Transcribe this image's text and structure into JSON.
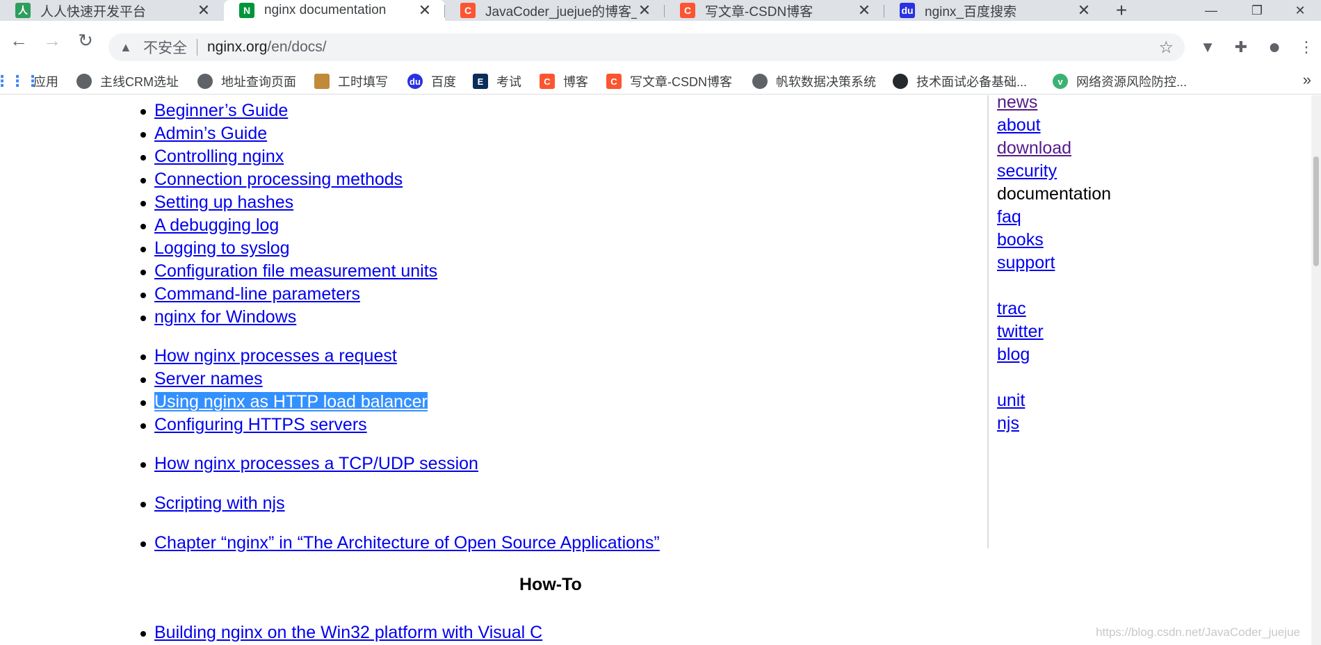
{
  "tabs": [
    {
      "title": "人人快速开发平台",
      "favicon": "renren-icon",
      "color": "#2e9e5b",
      "glyph": "人",
      "active": false
    },
    {
      "title": "nginx documentation",
      "favicon": "nginx-icon",
      "color": "#009639",
      "glyph": "N",
      "active": true
    },
    {
      "title": "JavaCoder_juejue的博客_掘…",
      "favicon": "csdn-icon",
      "color": "#fc5531",
      "glyph": "C",
      "active": false
    },
    {
      "title": "写文章-CSDN博客",
      "favicon": "csdn-icon",
      "color": "#fc5531",
      "glyph": "C",
      "active": false
    },
    {
      "title": "nginx_百度搜索",
      "favicon": "baidu-icon",
      "color": "#2932e1",
      "glyph": "du",
      "active": false
    }
  ],
  "tab_close_glyph": "✕",
  "new_tab_glyph": "+",
  "window_controls": {
    "minimize": "—",
    "restore": "❐",
    "close": "✕"
  },
  "toolbar": {
    "back": "←",
    "forward": "→",
    "reload": "↻",
    "security_label": "不安全",
    "url_host": "nginx.org",
    "url_path": "/en/docs/",
    "star": "☆",
    "ext1": "▼",
    "ext2": "✚",
    "profile": "●",
    "menu": "⋮"
  },
  "bookmarks": [
    {
      "label": "应用",
      "icon": "apps-icon",
      "glyph": "⋮⋮⋮",
      "cls": "apps"
    },
    {
      "label": "主线CRM选址",
      "icon": "globe-icon",
      "glyph": "",
      "cls": "globe"
    },
    {
      "label": "地址查询页面",
      "icon": "globe-icon",
      "glyph": "",
      "cls": "globe"
    },
    {
      "label": "工时填写",
      "icon": "ruler-icon",
      "glyph": "",
      "cls": "ruler"
    },
    {
      "label": "百度",
      "icon": "baidu-icon",
      "glyph": "du",
      "cls": "baidu"
    },
    {
      "label": "考试",
      "icon": "e-icon",
      "glyph": "E",
      "cls": "e"
    },
    {
      "label": "博客",
      "icon": "csdn-icon",
      "glyph": "C",
      "cls": "csdn"
    },
    {
      "label": "写文章-CSDN博客",
      "icon": "csdn-icon",
      "glyph": "C",
      "cls": "csdn"
    },
    {
      "label": "帆软数据决策系统",
      "icon": "globe-icon",
      "glyph": "",
      "cls": "globe"
    },
    {
      "label": "技术面试必备基础...",
      "icon": "github-icon",
      "glyph": "",
      "cls": "gh"
    },
    {
      "label": "网络资源风险防控...",
      "icon": "v-icon",
      "glyph": "v",
      "cls": "v"
    }
  ],
  "bookmarks_more": "»",
  "doc_links": [
    "Beginner’s Guide",
    "Admin’s Guide",
    "Controlling nginx",
    "Connection processing methods",
    "Setting up hashes",
    "A debugging log",
    "Logging to syslog",
    "Configuration file measurement units",
    "Command-line parameters",
    "nginx for Windows",
    "How nginx processes a request",
    "Server names",
    "Using nginx as HTTP load balancer",
    "Configuring HTTPS servers",
    "How nginx processes a TCP/UDP session",
    "Scripting with njs",
    "Chapter “nginx” in “The Architecture of Open Source Applications”",
    "Building nginx on the Win32 platform with Visual C"
  ],
  "selected_link": "Using nginx as HTTP load balancer",
  "section_heading": "How-To",
  "sidenav": [
    {
      "label": "news",
      "link": true,
      "visited": true
    },
    {
      "label": "about",
      "link": true,
      "visited": false
    },
    {
      "label": "download",
      "link": true,
      "visited": true
    },
    {
      "label": "security",
      "link": true,
      "visited": false
    },
    {
      "label": "documentation",
      "link": false,
      "visited": false
    },
    {
      "label": "faq",
      "link": true,
      "visited": false
    },
    {
      "label": "books",
      "link": true,
      "visited": false
    },
    {
      "label": "support",
      "link": true,
      "visited": false
    },
    {
      "label": "trac",
      "link": true,
      "visited": false
    },
    {
      "label": "twitter",
      "link": true,
      "visited": false
    },
    {
      "label": "blog",
      "link": true,
      "visited": false
    },
    {
      "label": "unit",
      "link": true,
      "visited": false
    },
    {
      "label": "njs",
      "link": true,
      "visited": false
    }
  ],
  "watermark": "https://blog.csdn.net/JavaCoder_juejue"
}
